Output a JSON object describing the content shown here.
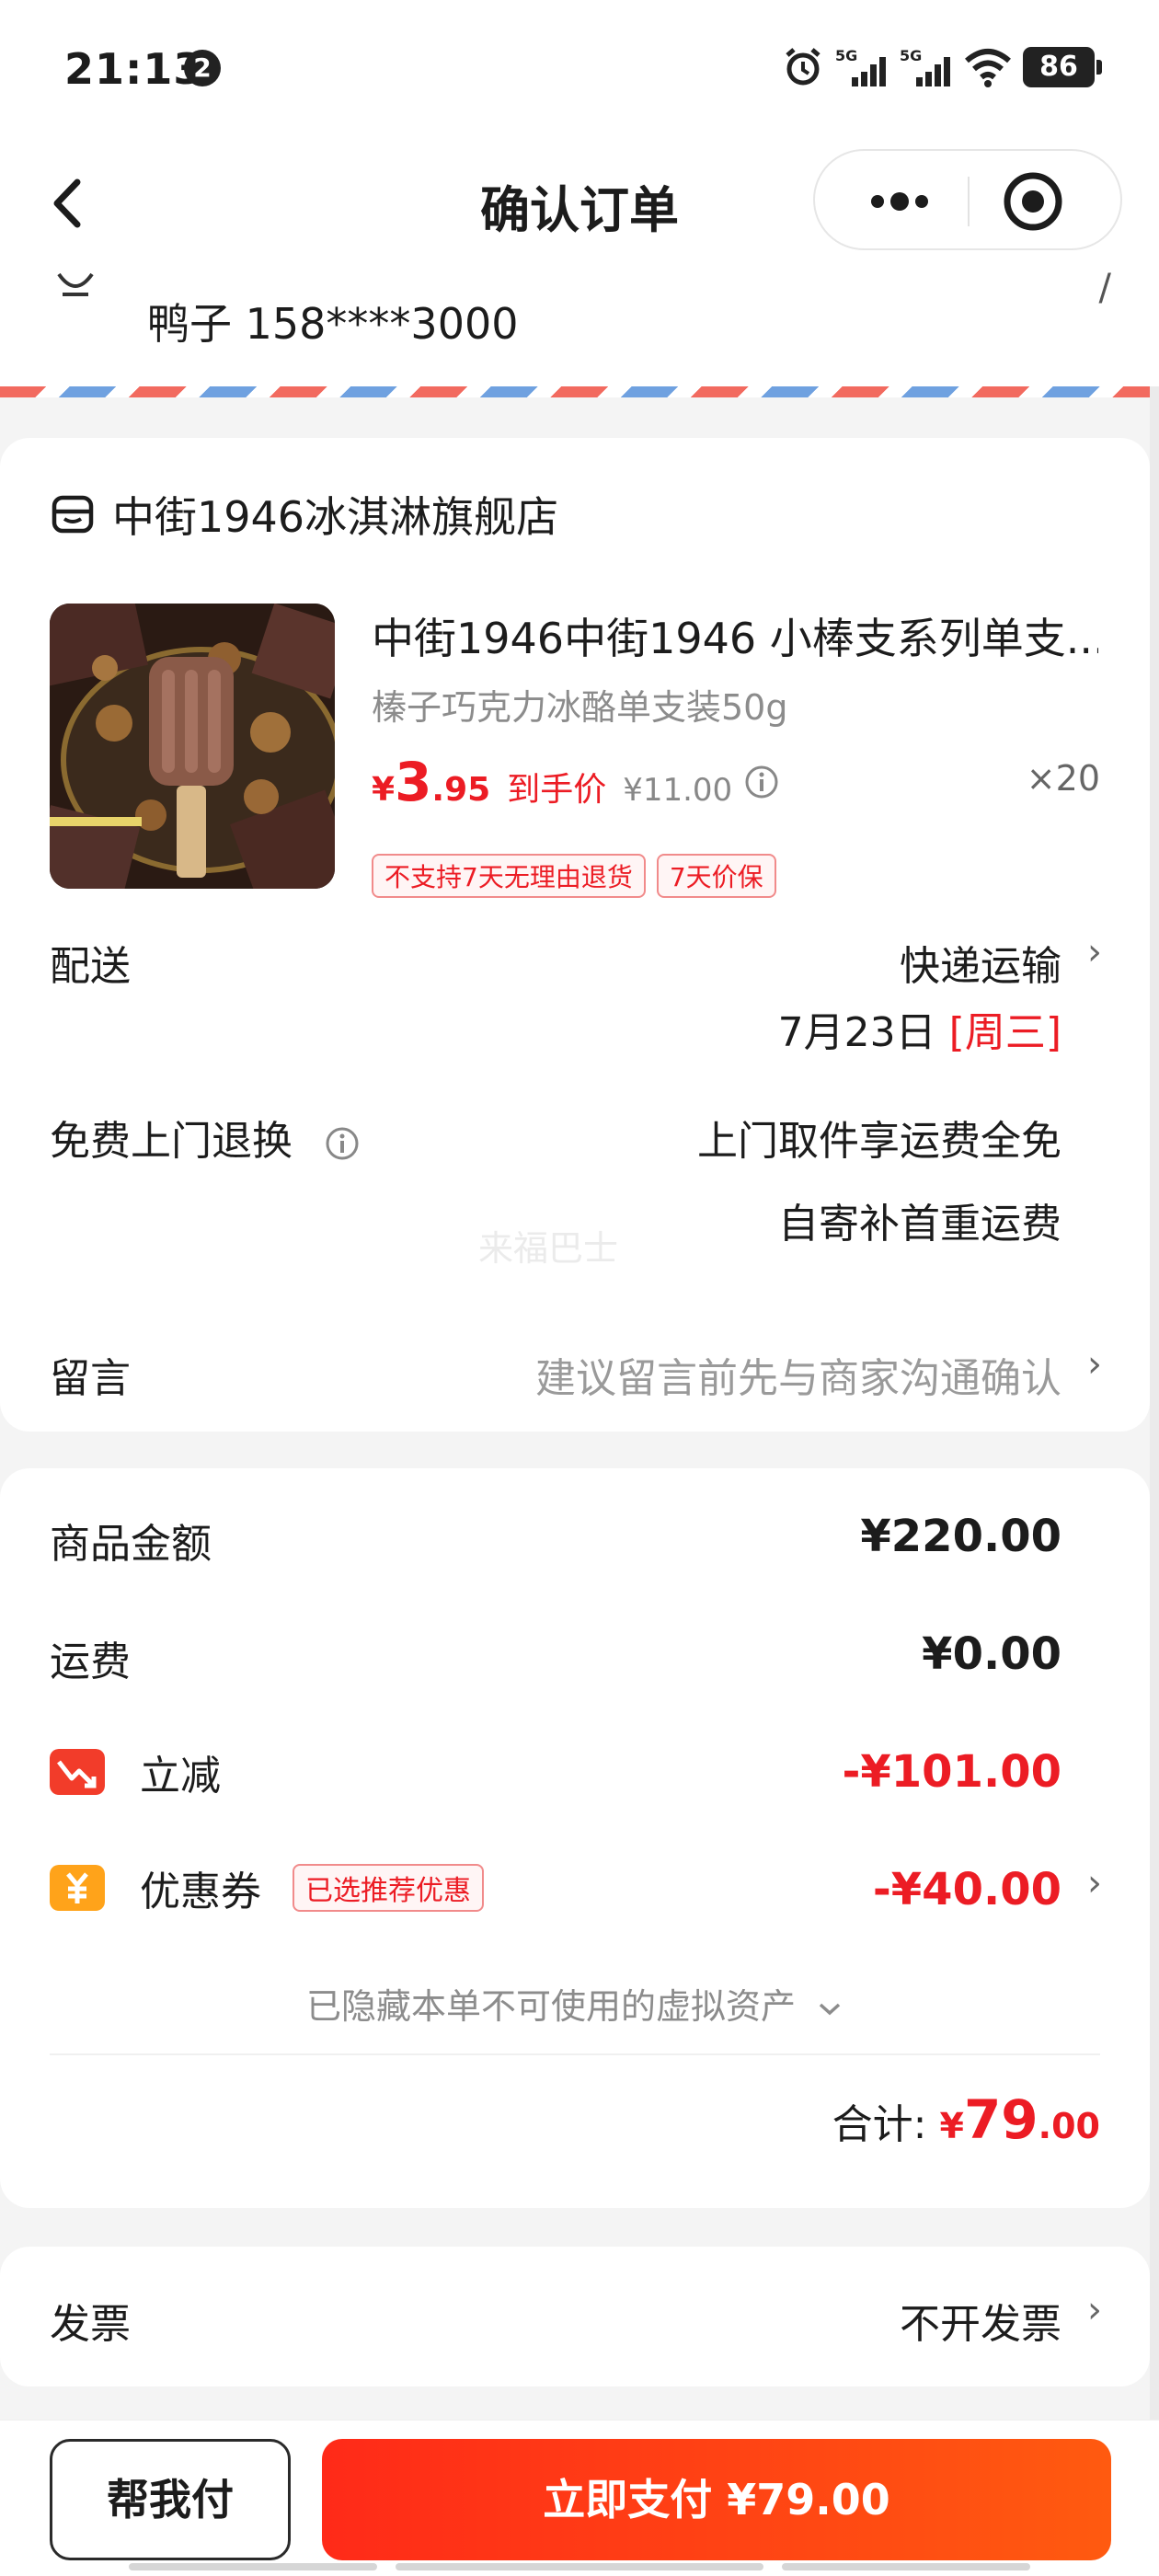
{
  "status_bar": {
    "time": "21:13",
    "notification_count": "2",
    "network_1": "5G",
    "network_2": "5G",
    "battery": "86"
  },
  "nav": {
    "title": "确认订单"
  },
  "address": {
    "contact": "鸭子 158****3000"
  },
  "order": {
    "store_name": "中街1946冰淇淋旗舰店",
    "product": {
      "title": "中街1946中街1946 小棒支系列单支...",
      "spec": "榛子巧克力冰酪单支装50g",
      "currency": "¥",
      "price_int": "3",
      "price_dec": ".95",
      "price_label": "到手价",
      "original_price": "¥11.00",
      "quantity": "×20",
      "tags": [
        "不支持7天无理由退货",
        "7天价保"
      ]
    },
    "delivery": {
      "label": "配送",
      "method": "快递运输",
      "date": "7月23日",
      "weekday": "[周三]"
    },
    "return_service": {
      "label": "免费上门退换",
      "line1": "上门取件享运费全免",
      "line2": "自寄补首重运费"
    },
    "watermark": "来福巴士",
    "message": {
      "label": "留言",
      "placeholder": "建议留言前先与商家沟通确认"
    }
  },
  "summary": {
    "goods": {
      "label": "商品金额",
      "value": "¥220.00"
    },
    "shipping": {
      "label": "运费",
      "value": "¥0.00"
    },
    "discount": {
      "label": "立减",
      "value": "-¥101.00"
    },
    "coupon": {
      "label": "优惠券",
      "chip": "已选推荐优惠",
      "value": "-¥40.00"
    },
    "hidden_assets": "已隐藏本单不可使用的虚拟资产",
    "total_label": "合计:",
    "total_currency": "¥",
    "total_int": "79",
    "total_dec": ".00"
  },
  "invoice": {
    "label": "发票",
    "value": "不开发票"
  },
  "bottom": {
    "help_pay": "帮我付",
    "pay_now": "立即支付 ¥79.00"
  },
  "colors": {
    "accent_red": "#ec1c24",
    "pay_button": "#ff3a14"
  }
}
